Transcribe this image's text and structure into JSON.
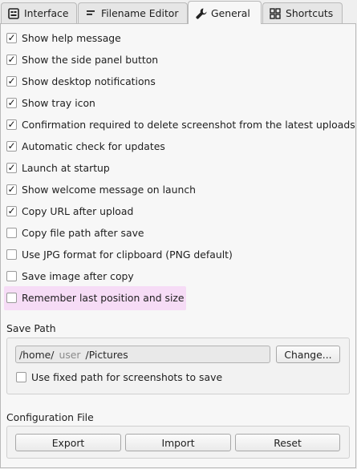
{
  "tabs": [
    {
      "label": "Interface",
      "icon": "interface-icon",
      "active": false
    },
    {
      "label": "Filename Editor",
      "icon": "text-lines-icon",
      "active": false
    },
    {
      "label": "General",
      "icon": "wrench-icon",
      "active": true
    },
    {
      "label": "Shortcuts",
      "icon": "shortcuts-grid-icon",
      "active": false
    }
  ],
  "options": [
    {
      "label": "Show help message",
      "checked": true
    },
    {
      "label": "Show the side panel button",
      "checked": true
    },
    {
      "label": "Show desktop notifications",
      "checked": true
    },
    {
      "label": "Show tray icon",
      "checked": true
    },
    {
      "label": "Confirmation required to delete screenshot from the latest uploads",
      "checked": true
    },
    {
      "label": "Automatic check for updates",
      "checked": true
    },
    {
      "label": "Launch at startup",
      "checked": true
    },
    {
      "label": "Show welcome message on launch",
      "checked": true
    },
    {
      "label": "Copy URL after upload",
      "checked": true
    },
    {
      "label": "Copy file path after save",
      "checked": false
    },
    {
      "label": "Use JPG format for clipboard (PNG default)",
      "checked": false
    },
    {
      "label": "Save image after copy",
      "checked": false
    },
    {
      "label": "Remember last position and size",
      "checked": false
    }
  ],
  "save_path": {
    "title": "Save Path",
    "path_prefix": "/home/",
    "path_user": "user",
    "path_suffix": "/Pictures",
    "change_label": "Change...",
    "fixed_path_label": "Use fixed path for screenshots to save",
    "fixed_path_checked": false
  },
  "config": {
    "title": "Configuration File",
    "export_label": "Export",
    "import_label": "Import",
    "reset_label": "Reset"
  },
  "colors": {
    "highlight": "#f6dcf6"
  }
}
